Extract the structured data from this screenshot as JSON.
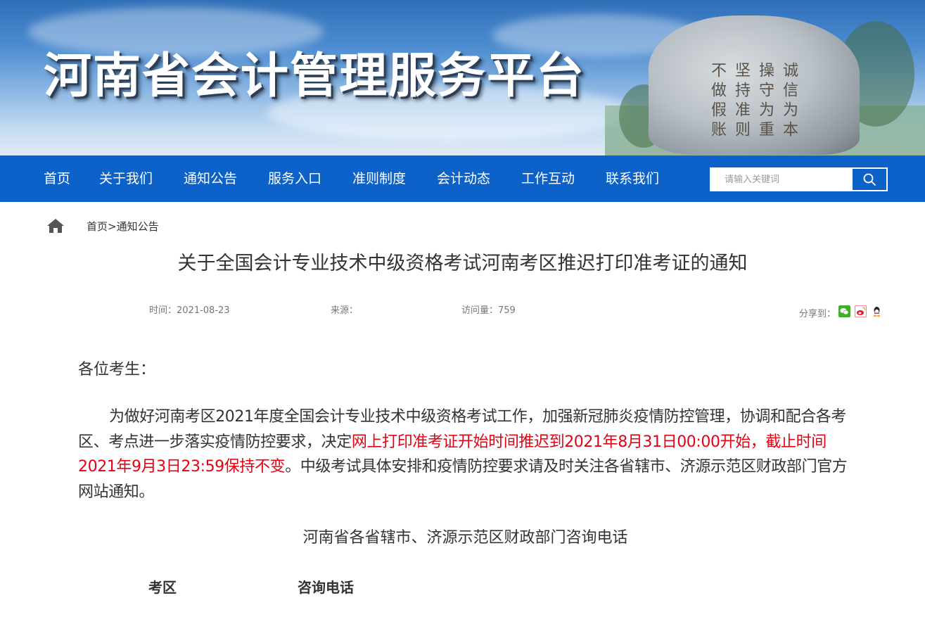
{
  "header": {
    "site_title": "河南省会计管理服务平台",
    "stone_text": [
      "诚信为本",
      "操守为重",
      "坚持准则",
      "不做假账"
    ]
  },
  "nav": {
    "items": [
      {
        "label": "首页"
      },
      {
        "label": "关于我们"
      },
      {
        "label": "通知公告"
      },
      {
        "label": "服务入口"
      },
      {
        "label": "准则制度"
      },
      {
        "label": "会计动态"
      },
      {
        "label": "工作互动"
      },
      {
        "label": "联系我们"
      }
    ],
    "search_placeholder": "请输入关键词",
    "search_icon": "magnifier-icon"
  },
  "breadcrumb": {
    "home_icon": "home-icon",
    "home": "首页",
    "separator": ">",
    "current": "通知公告"
  },
  "article": {
    "title": "关于全国会计专业技术中级资格考试河南考区推迟打印准考证的通知",
    "time": "时间：2021-08-23",
    "source": "来源：",
    "views": "访问量：759",
    "share_label": "分享到：",
    "share_icons": [
      "wechat-icon",
      "weibo-icon",
      "qq-icon"
    ],
    "greeting": "各位考生：",
    "paragraph_part1": "为做好河南考区2021年度全国会计专业技术中级资格考试工作，加强新冠肺炎疫情防控管理，协调和配合各考区、考点进一步落实疫情防控要求，决定",
    "paragraph_highlight": "网上打印准考证开始时间推迟到2021年8月31日00:00开始，截止时间2021年9月3日23:59保持不变",
    "paragraph_part2": "。中级考试具体安排和疫情防控要求请及时关注各省辖市、济源示范区财政部门官方网站通知。",
    "contact_heading": "河南省各省辖市、济源示范区财政部门咨询电话",
    "table_headers": [
      "考区",
      "咨询电话"
    ]
  },
  "colors": {
    "nav_bg": "#0c62c9",
    "highlight": "#e60012",
    "text": "#333333",
    "meta": "#777777"
  }
}
